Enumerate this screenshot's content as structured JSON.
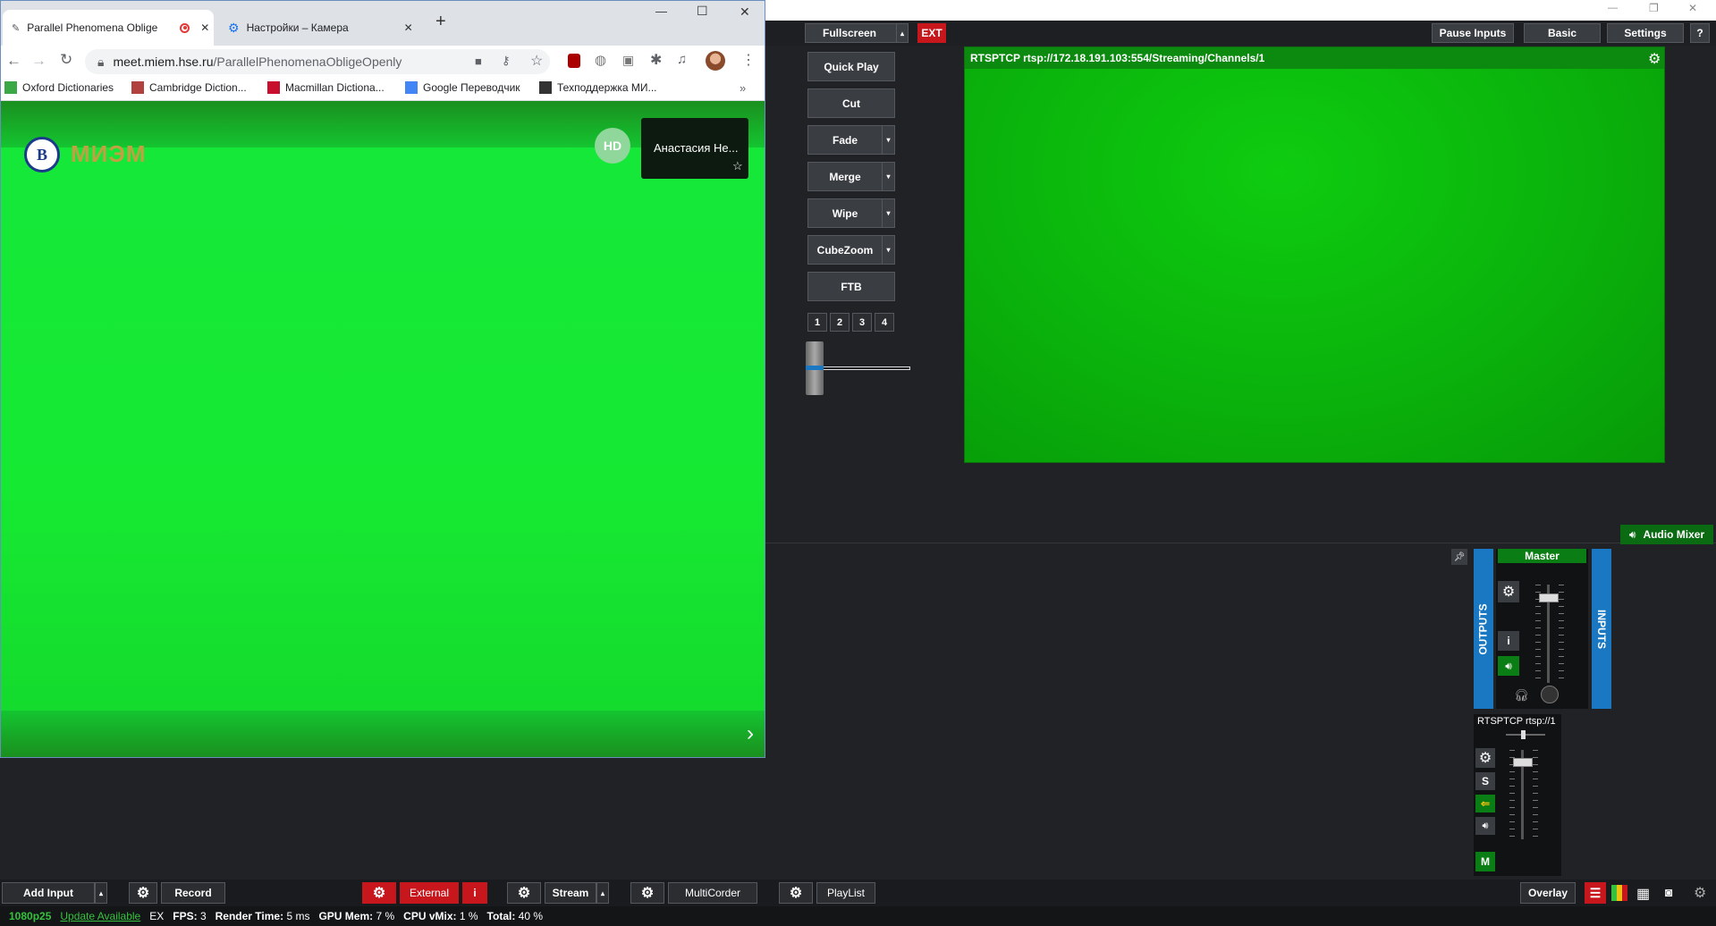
{
  "browser": {
    "tabs": [
      {
        "title": "Parallel Phenomena Oblige",
        "active": true
      },
      {
        "title": "Настройки – Камера",
        "active": false
      }
    ],
    "new_tab": "+",
    "window_controls": {
      "minimize": "—",
      "maximize": "☐",
      "close": "✕"
    },
    "address": {
      "domain": "meet.miem.hse.ru",
      "path": "/ParallelPhenomenaObligeOpenly"
    },
    "bookmarks": [
      {
        "label": "Oxford Dictionaries",
        "color": "#3aa845"
      },
      {
        "label": "Cambridge Diction...",
        "color": "#b0413e"
      },
      {
        "label": "Macmillan Dictiona...",
        "color": "#c8102e"
      },
      {
        "label": "Google Переводчик",
        "color": "#4285f4"
      },
      {
        "label": "Техподдержка МИ...",
        "color": "#333333"
      }
    ],
    "bookmarks_more": "»",
    "profile_label": "HD",
    "participant_name": "Анастасия Не...",
    "logo_text": "МИЭМ",
    "next_arrow": "›"
  },
  "vmix": {
    "title_controls": {
      "minimize": "—",
      "restore": "❐",
      "close": "✕"
    },
    "top": {
      "fullscreen": "Fullscreen",
      "ext": "EXT",
      "pause_inputs": "Pause Inputs",
      "basic": "Basic",
      "settings": "Settings",
      "help": "?"
    },
    "transitions": [
      {
        "label": "Quick Play",
        "dropdown": false
      },
      {
        "label": "Cut",
        "dropdown": false
      },
      {
        "label": "Fade",
        "dropdown": true
      },
      {
        "label": "Merge",
        "dropdown": true
      },
      {
        "label": "Wipe",
        "dropdown": true
      },
      {
        "label": "CubeZoom",
        "dropdown": true
      },
      {
        "label": "FTB",
        "dropdown": false
      }
    ],
    "numbers": [
      "1",
      "2",
      "3",
      "4"
    ],
    "tbar_position": 0.55,
    "preview_title": "RTSPTCP rtsp://172.18.191.103:554/Streaming/Channels/1",
    "audio_mixer": "Audio Mixer",
    "outputs": "OUTPUTS",
    "inputs": "INPUTS",
    "master": "Master",
    "master_volume": 0.9,
    "input_strip": "RTSPTCP rtsp://1",
    "input_volume": 0.9,
    "input_buttons": {
      "solo": "S",
      "mute": "M",
      "info": "i"
    },
    "bottom": {
      "add_input": "Add Input",
      "record": "Record",
      "external": "External",
      "external_info": "i",
      "stream": "Stream",
      "multicorder": "MultiCorder",
      "playlist": "PlayList",
      "overlay": "Overlay"
    },
    "status": {
      "format": "1080p25",
      "update": "Update Available",
      "ex": "EX",
      "fps_label": "FPS:",
      "fps": "3",
      "render_label": "Render Time:",
      "render": "5 ms",
      "gpu_label": "GPU Mem:",
      "gpu": "7 %",
      "cpu_label": "CPU vMix:",
      "cpu": "1 %",
      "total_label": "Total:",
      "total": "40 %"
    },
    "colors": {
      "accent_blue": "#1a78c2",
      "record_red": "#c8161d",
      "master_green": "#0a7d14",
      "status_green": "#35c13e"
    }
  }
}
